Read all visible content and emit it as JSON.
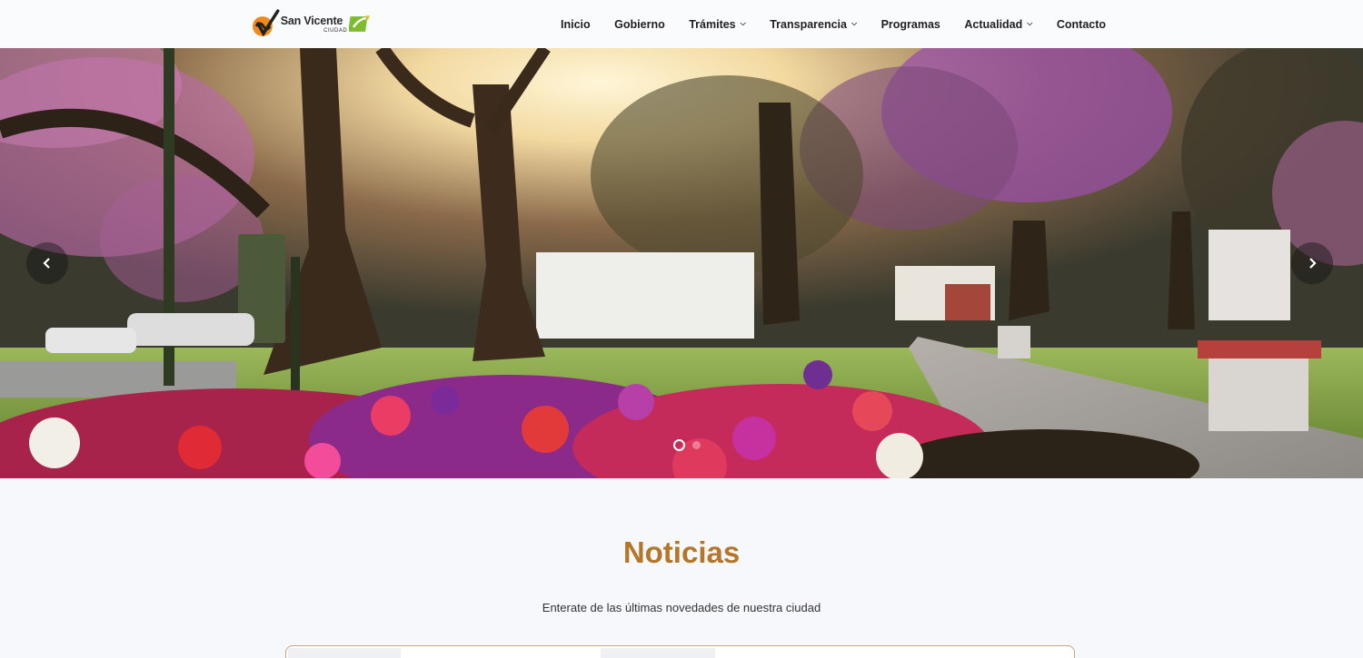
{
  "header": {
    "logo": {
      "name": "San Vicente",
      "sub": "CIUDAD"
    },
    "nav": [
      {
        "label": "Inicio",
        "dropdown": false
      },
      {
        "label": "Gobierno",
        "dropdown": false
      },
      {
        "label": "Trámites",
        "dropdown": true
      },
      {
        "label": "Transparencia",
        "dropdown": true
      },
      {
        "label": "Programas",
        "dropdown": false
      },
      {
        "label": "Actualidad",
        "dropdown": true
      },
      {
        "label": "Contacto",
        "dropdown": false
      }
    ]
  },
  "hero": {
    "slides_count": 2,
    "active_slide": 1,
    "prev_icon": "chevron-left-icon",
    "next_icon": "chevron-right-icon"
  },
  "news": {
    "title": "Noticias",
    "subtitle": "Enterate de las últimas novedades de nuestra ciudad"
  },
  "colors": {
    "accent": "#b5762a",
    "logo_orange": "#f08a1c",
    "logo_green": "#7dbb2f"
  }
}
